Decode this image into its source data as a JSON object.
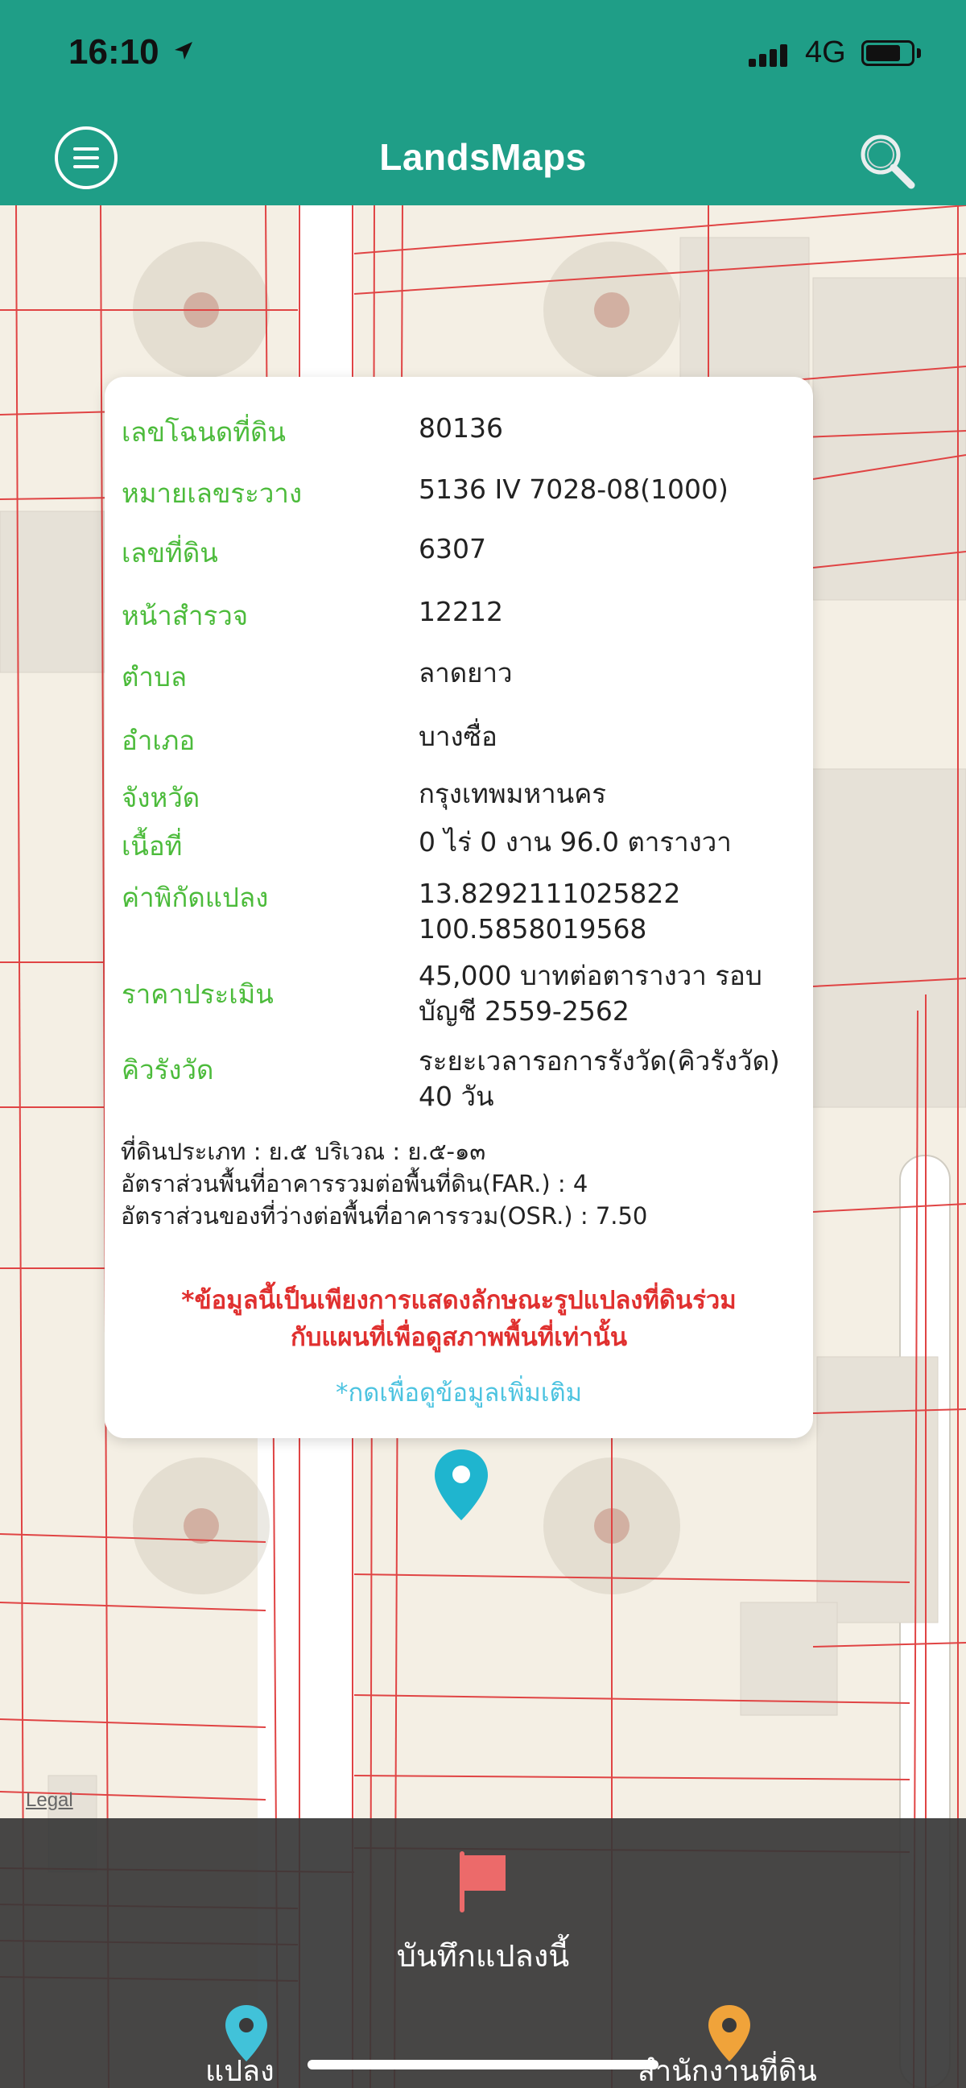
{
  "status_bar": {
    "time": "16:10",
    "network": "4G"
  },
  "header": {
    "title": "LandsMaps",
    "menu_icon": "hamburger-menu-icon",
    "search_icon": "magnifier-icon"
  },
  "parcel_info": {
    "rows": [
      {
        "label": "เลขโฉนดที่ดิน",
        "value": "80136"
      },
      {
        "label": "หมายเลขระวาง",
        "value": "5136 IV 7028-08(1000)"
      },
      {
        "label": "เลขที่ดิน",
        "value": "6307"
      },
      {
        "label": "หน้าสำรวจ",
        "value": "12212"
      },
      {
        "label": "ตำบล",
        "value": "ลาดยาว"
      },
      {
        "label": "อำเภอ",
        "value": "บางซื่อ"
      },
      {
        "label": "จังหวัด",
        "value": "กรุงเทพมหานคร"
      },
      {
        "label": "เนื้อที่",
        "value": "0 ไร่ 0 งาน 96.0 ตารางวา"
      },
      {
        "label": "ค่าพิกัดแปลง",
        "value_line1": "13.8292111025822",
        "value_line2": "100.5858019568"
      },
      {
        "label": "ราคาประเมิน",
        "value_line1": "45,000 บาทต่อตารางวา รอบ",
        "value_line2": "บัญชี 2559-2562"
      },
      {
        "label": "คิวรังวัด",
        "value_line1": "ระยะเวลารอการรังวัด(คิวรังวัด)",
        "value_line2": "40 วัน"
      }
    ],
    "land_type": "ที่ดินประเภท : ย.๕  บริเวณ : ย.๕-๑๓",
    "far": "อัตราส่วนพื้นที่อาคารรวมต่อพื้นที่ดิน(FAR.) : 4",
    "osr": "อัตราส่วนของที่ว่างต่อพื้นที่อาคารรวม(OSR.) : 7.50",
    "disclaimer_line1": "*ข้อมูลนี้เป็นเพียงการแสดงลักษณะรูปแปลงที่ดินร่วม",
    "disclaimer_line2": "กับแผนที่เพื่อดูสภาพพื้นที่เท่านั้น",
    "more_link": "*กดเพื่อดูข้อมูลเพิ่มเติม"
  },
  "bottom_bar": {
    "save_label": "บันทึกแปลงนี้",
    "parcel_label": "แปลง",
    "office_label": "สำนักงานที่ดิน",
    "legal": "Legal",
    "colors": {
      "parcel_pin": "#41c2d9",
      "office_pin": "#f0a33a",
      "flag": "#ec6a6a"
    }
  },
  "colors": {
    "header": "#1f9e87",
    "label_green": "#4cbb3b",
    "disclaimer_red": "#e0302f",
    "link_blue": "#4cc3e0",
    "map_pin": "#1fb5cf"
  }
}
